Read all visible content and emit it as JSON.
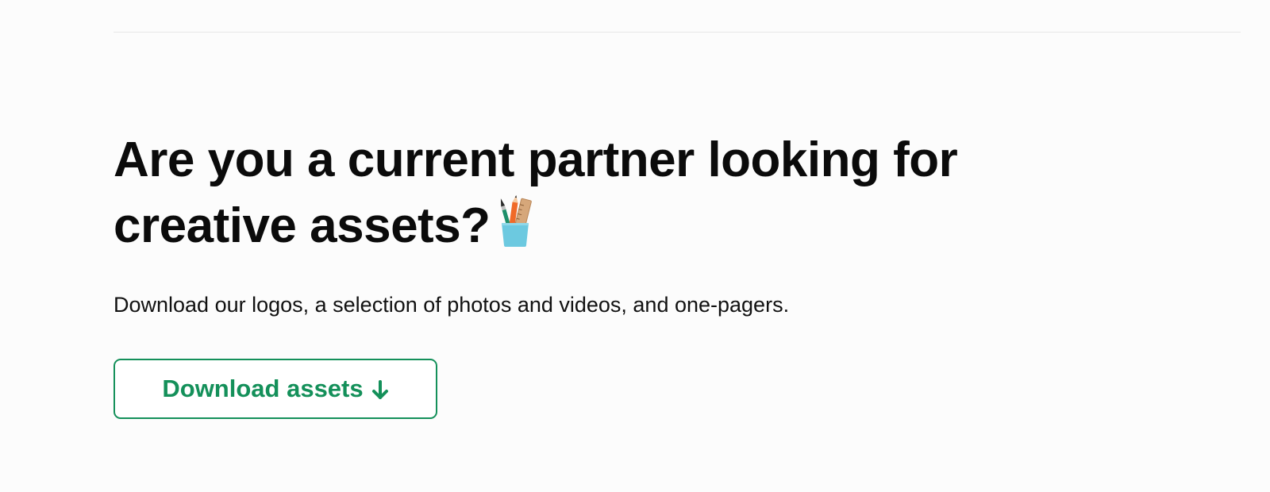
{
  "partner_section": {
    "headline_line1": "Are you a current partner looking for",
    "headline_line2": "creative assets?",
    "headline_icon": "pencil-cup-icon",
    "description": "Download our logos, a selection of photos and videos, and one-pagers.",
    "button_label": "Download assets",
    "button_icon": "arrow-down-icon"
  },
  "colors": {
    "accent": "#14905a",
    "text": "#0b0b0b",
    "background": "#fcfcfc",
    "divider": "#e8e8e8"
  }
}
